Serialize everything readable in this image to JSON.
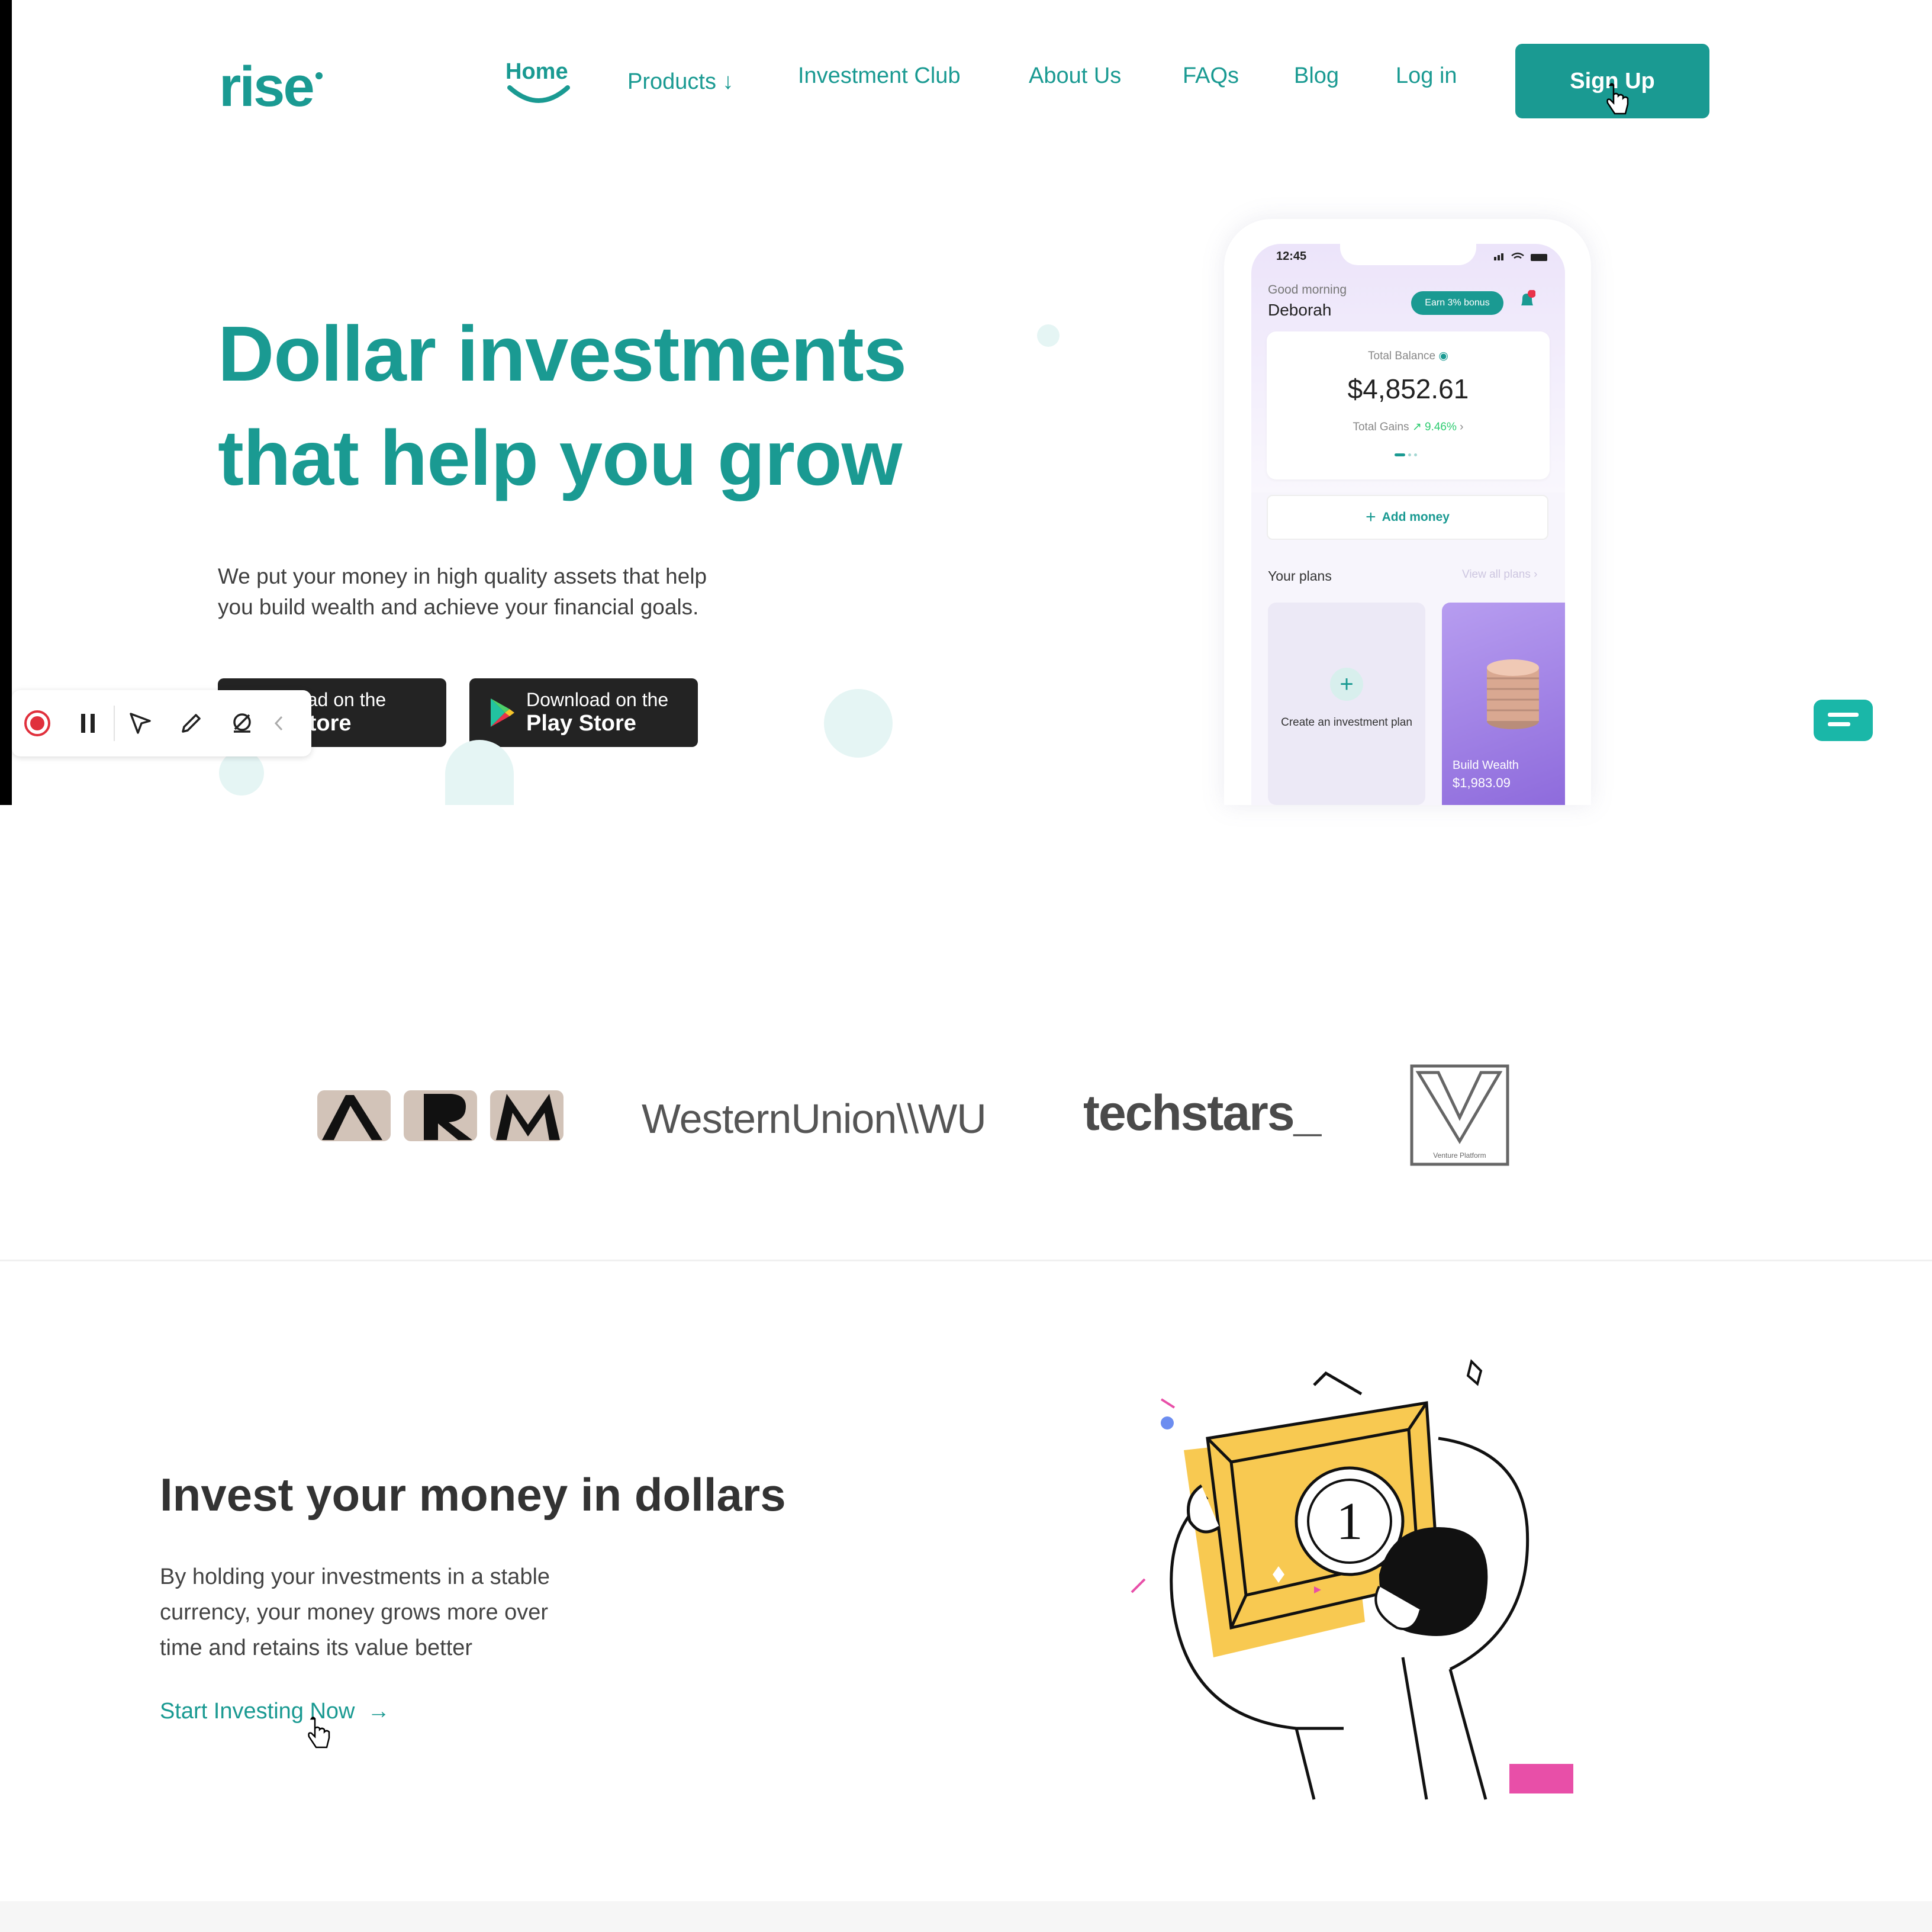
{
  "nav": {
    "logo": "rise",
    "home": "Home",
    "products": "Products ↓",
    "investment_club": "Investment Club",
    "about": "About Us",
    "faqs": "FAQs",
    "blog": "Blog",
    "login": "Log in",
    "signup": "Sign Up"
  },
  "hero": {
    "title_line1": "Dollar investments",
    "title_line2": "that help you grow",
    "subtitle_line1": "We put your money in high quality assets that help",
    "subtitle_line2": "you build wealth and achieve your financial goals.",
    "app_store_small": "Download on the",
    "app_store_big": "App Store",
    "play_store_small": "Download on the",
    "play_store_big": "Play Store"
  },
  "phone": {
    "time": "12:45",
    "greeting": "Good morning",
    "name": "Deborah",
    "bonus": "Earn 3% bonus",
    "balance_label": "Total Balance",
    "balance": "$4,852.61",
    "gains_label": "Total Gains",
    "gains_value": "9.46%",
    "add_money": "Add money",
    "your_plans": "Your plans",
    "view_all": "View all plans",
    "create_plan": "Create an investment plan",
    "plan_name": "Build Wealth",
    "plan_amount": "$1,983.09"
  },
  "partners": {
    "arm": "ARM",
    "western_union": "WesternUnion\\\\WU",
    "techstars": "techstars_",
    "venture_platform": "Venture Platform"
  },
  "section2": {
    "title": "Invest your money in dollars",
    "body_line1": "By holding your investments in a stable",
    "body_line2": "currency, your money grows more over",
    "body_line3": "time and retains its value better",
    "cta": "Start Investing Now",
    "cta_arrow": "→",
    "medal_number": "1"
  },
  "colors": {
    "brand": "#1a9a92",
    "button_dark": "#232323",
    "record_red": "#e0303c"
  },
  "icons": [
    "smile-underline-icon",
    "cursor-hand-icon",
    "play-store-icon",
    "record-icon",
    "pause-icon",
    "pointer-icon",
    "pencil-icon",
    "eraser-icon",
    "chevron-left-icon",
    "chat-icon",
    "bell-icon",
    "eye-icon",
    "plus-icon"
  ]
}
